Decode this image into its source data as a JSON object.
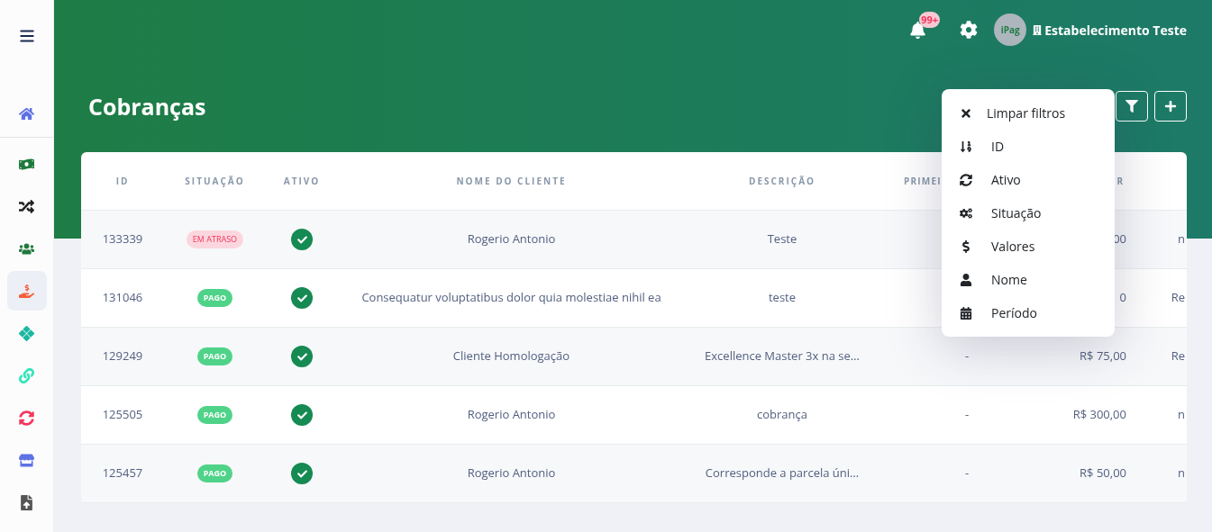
{
  "sidebar": {
    "items": [
      {
        "color": "#5e72e4",
        "selected": false
      },
      {
        "color": "#1e7a3c",
        "selected": false
      },
      {
        "color": "#222222",
        "selected": false
      },
      {
        "color": "#1e7a3c",
        "selected": false
      },
      {
        "color": "#f5613a",
        "selected": true
      },
      {
        "color": "#1bb8a0",
        "selected": false
      },
      {
        "color": "#2ee6b8",
        "selected": false
      },
      {
        "color": "#f5365c",
        "selected": false
      },
      {
        "color": "#5e72e4",
        "selected": false
      },
      {
        "color": "#555555",
        "selected": false
      }
    ]
  },
  "topbar": {
    "notifications": "99+",
    "avatar": "iPag",
    "establishment": "Estabelecimento Teste"
  },
  "page_title": "Cobranças",
  "table": {
    "columns": [
      "ID",
      "SITUAÇÃO",
      "ATIVO",
      "NOME DO CLIENTE",
      "DESCRIÇÃO",
      "PRIMEI",
      "R"
    ],
    "rows": [
      {
        "id": "133339",
        "status": {
          "text": "EM ATRASO",
          "kind": "late"
        },
        "active": true,
        "client": "Rogerio Antonio",
        "description": "Teste",
        "value": "00",
        "column_8": "n"
      },
      {
        "id": "131046",
        "status": {
          "text": "PAGO",
          "kind": "paid"
        },
        "active": true,
        "client": "Consequatur voluptatibus dolor quia molestiae nihil ea",
        "description": "teste",
        "value": "0",
        "column_8": "Re"
      },
      {
        "id": "129249",
        "status": {
          "text": "PAGO",
          "kind": "paid"
        },
        "active": true,
        "client": "Cliente Homologação",
        "description": "Excellence Master 3x na se…",
        "first": "-",
        "value": "R$ 75,00",
        "column_8": "Re"
      },
      {
        "id": "125505",
        "status": {
          "text": "PAGO",
          "kind": "paid"
        },
        "active": true,
        "client": "Rogerio Antonio",
        "description": "cobrança",
        "first": "-",
        "value": "R$ 300,00",
        "column_8": "n"
      },
      {
        "id": "125457",
        "status": {
          "text": "PAGO",
          "kind": "paid"
        },
        "active": true,
        "client": "Rogerio Antonio",
        "description": "Corresponde a parcela úni…",
        "first": "-",
        "value": "R$ 50,00",
        "column_8": "n"
      }
    ]
  },
  "filter_menu": {
    "items": [
      {
        "label": "Limpar filtros"
      },
      {
        "label": "ID"
      },
      {
        "label": "Ativo"
      },
      {
        "label": "Situação"
      },
      {
        "label": "Valores"
      },
      {
        "label": "Nome"
      },
      {
        "label": "Período"
      }
    ]
  }
}
